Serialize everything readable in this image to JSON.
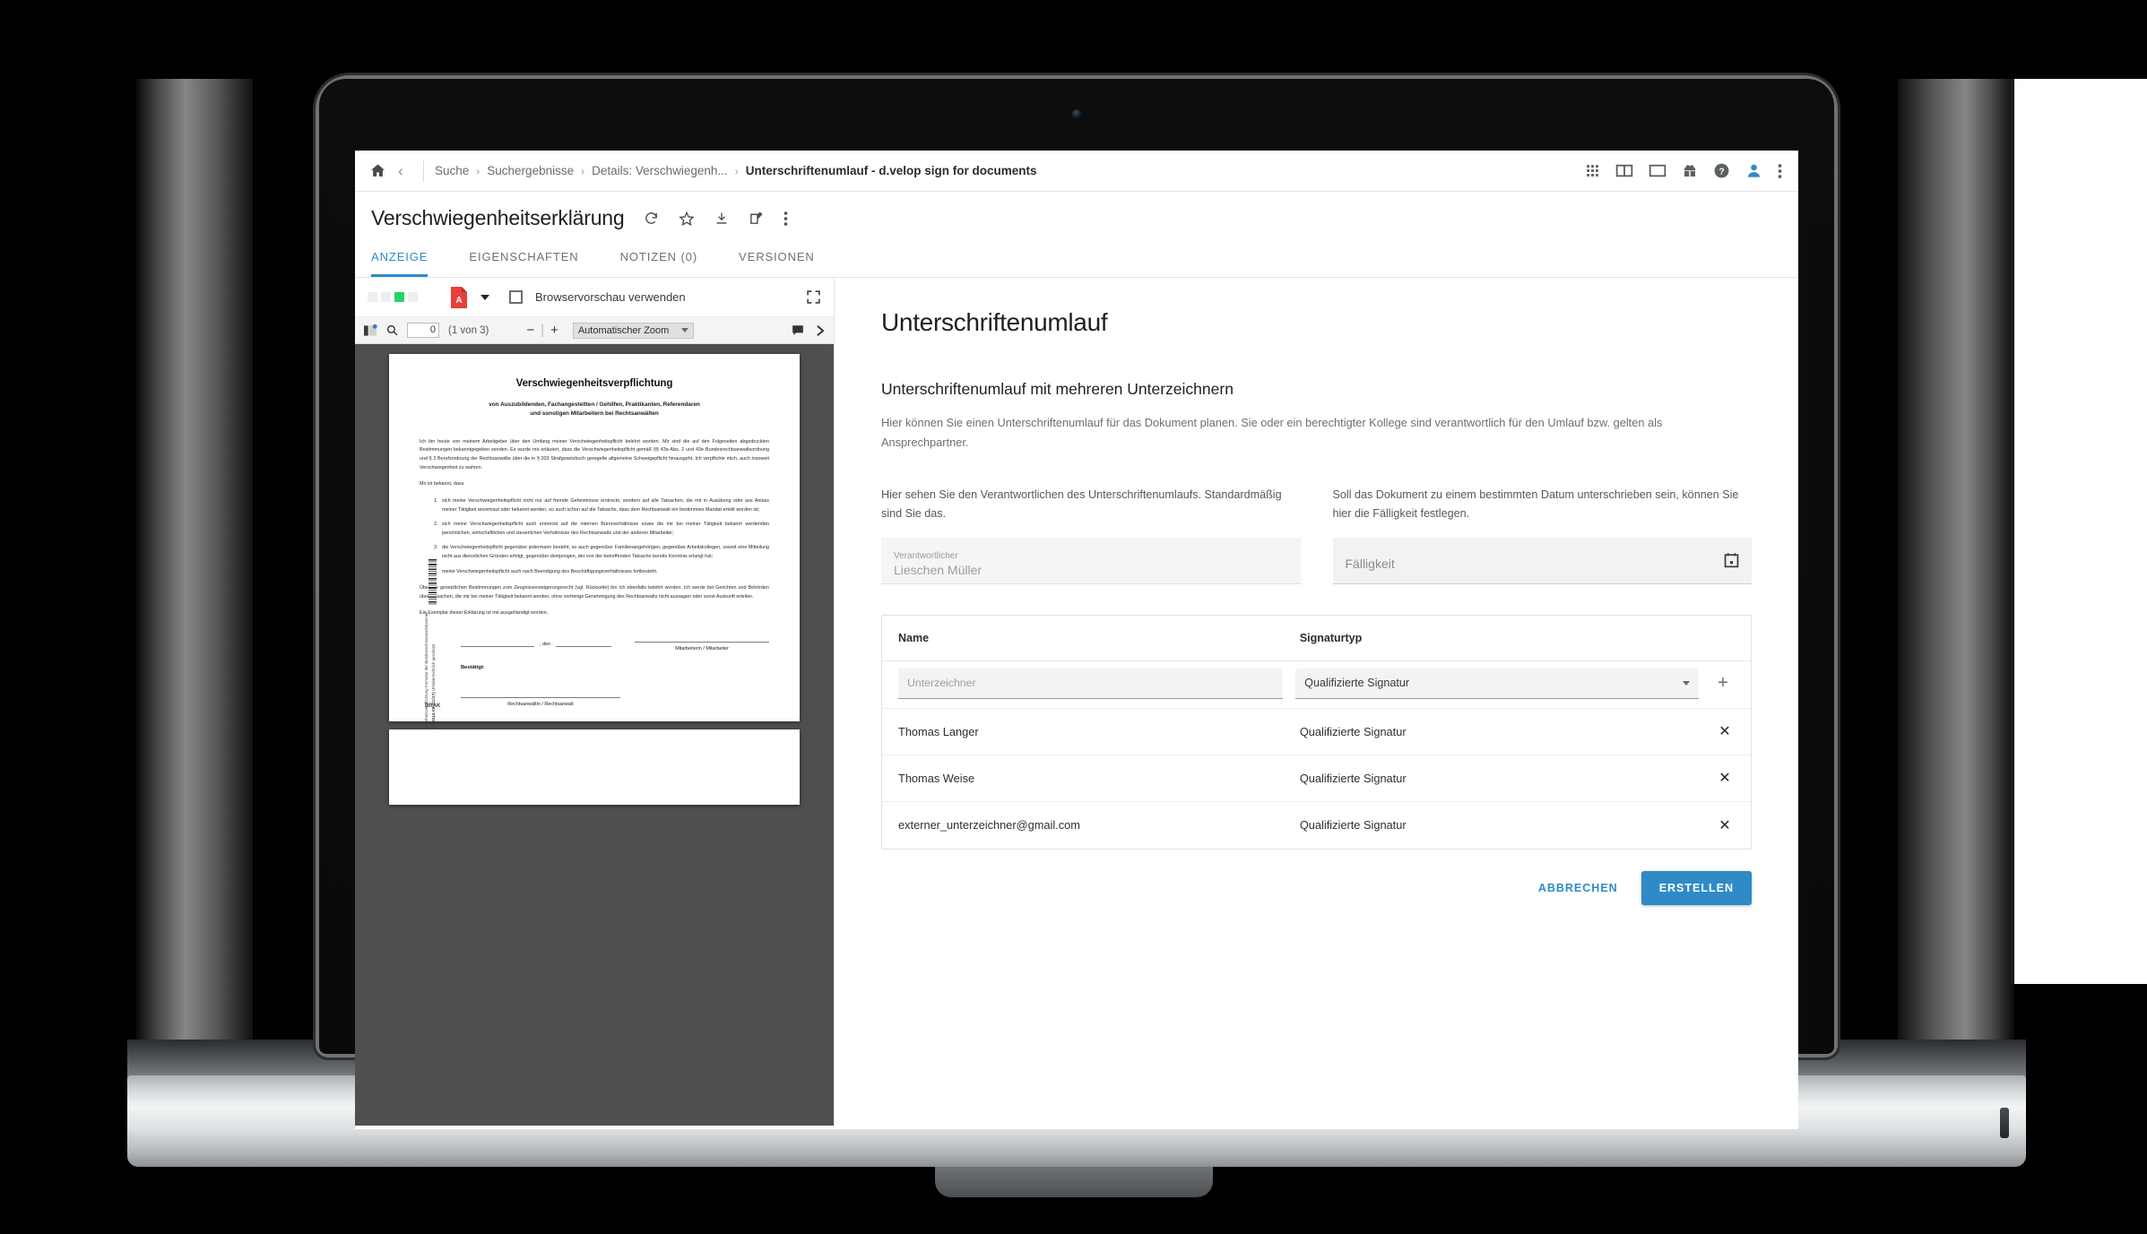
{
  "breadcrumb": {
    "home_icon": "home-icon",
    "back_icon": "chevron-left-icon",
    "items": [
      "Suche",
      "Suchergebnisse",
      "Details: Verschwiegenh...",
      "Unterschriftenumlauf - d.velop sign for documents"
    ],
    "separator": "›"
  },
  "top_icons": [
    "apps-grid-icon",
    "split-view-icon",
    "single-view-icon",
    "gift-icon",
    "help-icon",
    "user-avatar-icon",
    "kebab-menu-icon"
  ],
  "document": {
    "title": "Verschwiegenheitserklärung",
    "actions": [
      "refresh-icon",
      "star-icon",
      "download-icon",
      "edit-icon",
      "kebab-menu-icon"
    ]
  },
  "tabs": [
    {
      "label": "ANZEIGE",
      "active": true
    },
    {
      "label": "EIGENSCHAFTEN",
      "active": false
    },
    {
      "label": "NOTIZEN (0)",
      "active": false
    },
    {
      "label": "VERSIONEN",
      "active": false
    }
  ],
  "viewer_toolbar": {
    "status_squares": [
      "gray",
      "gray",
      "green",
      "gray"
    ],
    "pdf_icon": "pdf-file-icon",
    "dropdown_icon": "caret-down-icon",
    "checkbox_label": "Browservorschau verwenden",
    "checkbox_checked": false,
    "expand_icon": "fullscreen-icon"
  },
  "pdf_bar": {
    "sidebar_icon": "toggle-sidebar-icon",
    "search_icon": "search-icon",
    "page_value": "0",
    "page_count": "(1 von 3)",
    "zoom_out": "−",
    "zoom_in": "+",
    "zoom_select": "Automatischer Zoom",
    "zoom_caret": "caret-down-icon",
    "comment_icon": "comment-icon",
    "next_icon": "chevron-right-icon"
  },
  "pdf_document": {
    "heading": "Verschwiegenheitsverpflichtung",
    "subheading_line1": "von Auszubildenden, Fachangestellten / Gehilfen, Praktikanten, Referendaren",
    "subheading_line2": "und sonstigen Mitarbeitern bei Rechtsanwälten",
    "paragraph1": "Ich bin heute von meinem Arbeitgeber über den Umfang meiner Verschwiegenheitspflicht belehrt worden. Mir sind die auf den Folgeseiten abgedruckten Bestimmungen bekanntgegeben worden. Es wurde mir erläutert, dass die Verschwiegenheitspflicht gemäß §§ 43a Abs. 2 und 43e Bundesrechtsanwaltsordnung und § 2 Berufsordnung der Rechtsanwälte über die in § 203 Strafgesetzbuch geregelte allgemeine Schweigepflicht hinausgeht. Ich verpflichte mich, auch insoweit Verschwiegenheit zu wahren.",
    "paragraph2": "Mir ist bekannt, dass",
    "list": [
      "sich meine Verschwiegenheitspflicht nicht nur auf fremde Geheimnisse erstreckt, sondern auf alle Tatsachen, die mir in Ausübung oder aus Anlass meiner Tätigkeit anvertraut oder bekannt werden, so auch schon auf die Tatsache, dass dem Rechtsanwalt ein bestimmtes Mandat erteilt worden ist;",
      "sich meine Verschwiegenheitspflicht auch erstreckt auf die internen Bürorverhältnisse sowie die mir bei meiner Tätigkeit bekannt werdenden persönlichen, wirtschaftlichen und steuerlichen Verhältnisse des Rechtsanwalts und der anderen Mitarbeiter;",
      "die Verschwiegenheitspflicht gegenüber jedermann besteht, so auch gegenüber Familienangehörigen, gegenüber Arbeitskollegen, soweit eine Mitteilung nicht aus dienstlichen Gründen erfolgt, gegenüber demjenigen, der von der betreffenden Tatsache bereits Kenntnis erlangt hat;",
      "meine Verschwiegenheitspflicht auch nach Beendigung des Beschäftigungsverhältnisses fortbesteht."
    ],
    "paragraph3": "Über die gesetzlichen Bestimmungen zum Zeugnisverweigerungsrecht (vgl. Rückseite) bin ich ebenfalls belehrt worden. Ich werde bei Gerichten und Behörden über Tatsachen, die mir bei meiner Tätigkeit bekannt werden, ohne vorherige Genehmigung des Rechtsanwalts nicht aussagen oder sonst Auskunft erteilen.",
    "paragraph4": "Ein Exemplar dieser Erklärung ist mir ausgehändigt worden.",
    "signature": {
      "den": ", den",
      "employee_label": "Mitarbeiterin / Mitarbeiter",
      "confirm_label": "Bestätigt:",
      "lawyer_label": "Rechtsanwältin / Rechtsanwalt"
    },
    "margin_text_1": "Verschwiegenheitsverpflichtung",
    "margin_text_2": "Formular der Bundesrechtsanwaltskammer",
    "margin_text_3": "Best.-Nr. 08244-08 (11/17)",
    "margin_text_4": "Urheberrechtlich geschützt",
    "margin_logo": "BRAK"
  },
  "panel": {
    "title": "Unterschriftenumlauf",
    "subtitle": "Unterschriftenumlauf mit mehreren Unterzeichnern",
    "intro": "Hier können Sie einen Unterschriftenumlauf für das Dokument planen. Sie oder ein berechtigter Kollege sind verantwortlich für den Umlauf bzw. gelten als Ansprechpartner.",
    "left_col": {
      "description": "Hier sehen Sie den Verantwortlichen des Unterschriftenumlaufs. Standardmäßig sind Sie das.",
      "field_label": "Verantwortlicher",
      "field_value": "Lieschen Müller"
    },
    "right_col": {
      "description": "Soll das Dokument zu einem bestimmten Datum unterschrieben sein, können Sie hier die Fälligkeit festlegen.",
      "field_placeholder": "Fälligkeit",
      "field_value": "",
      "calendar_icon": "calendar-icon"
    },
    "table": {
      "headers": [
        "Name",
        "Signaturtyp"
      ],
      "add_row": {
        "name_placeholder": "Unterzeichner",
        "signature_type": "Qualifizierte Signatur",
        "add_icon": "plus-icon"
      },
      "rows": [
        {
          "name": "Thomas Langer",
          "type": "Qualifizierte Signatur",
          "remove_icon": "close-icon"
        },
        {
          "name": "Thomas Weise",
          "type": "Qualifizierte Signatur",
          "remove_icon": "close-icon"
        },
        {
          "name": "externer_unterzeichner@gmail.com",
          "type": "Qualifizierte Signatur",
          "remove_icon": "close-icon"
        }
      ]
    },
    "cancel_label": "ABBRECHEN",
    "create_label": "ERSTELLEN"
  },
  "colors": {
    "accent": "#2e8bc7",
    "pdf_red": "#e8403a",
    "status_green": "#27d16a"
  }
}
